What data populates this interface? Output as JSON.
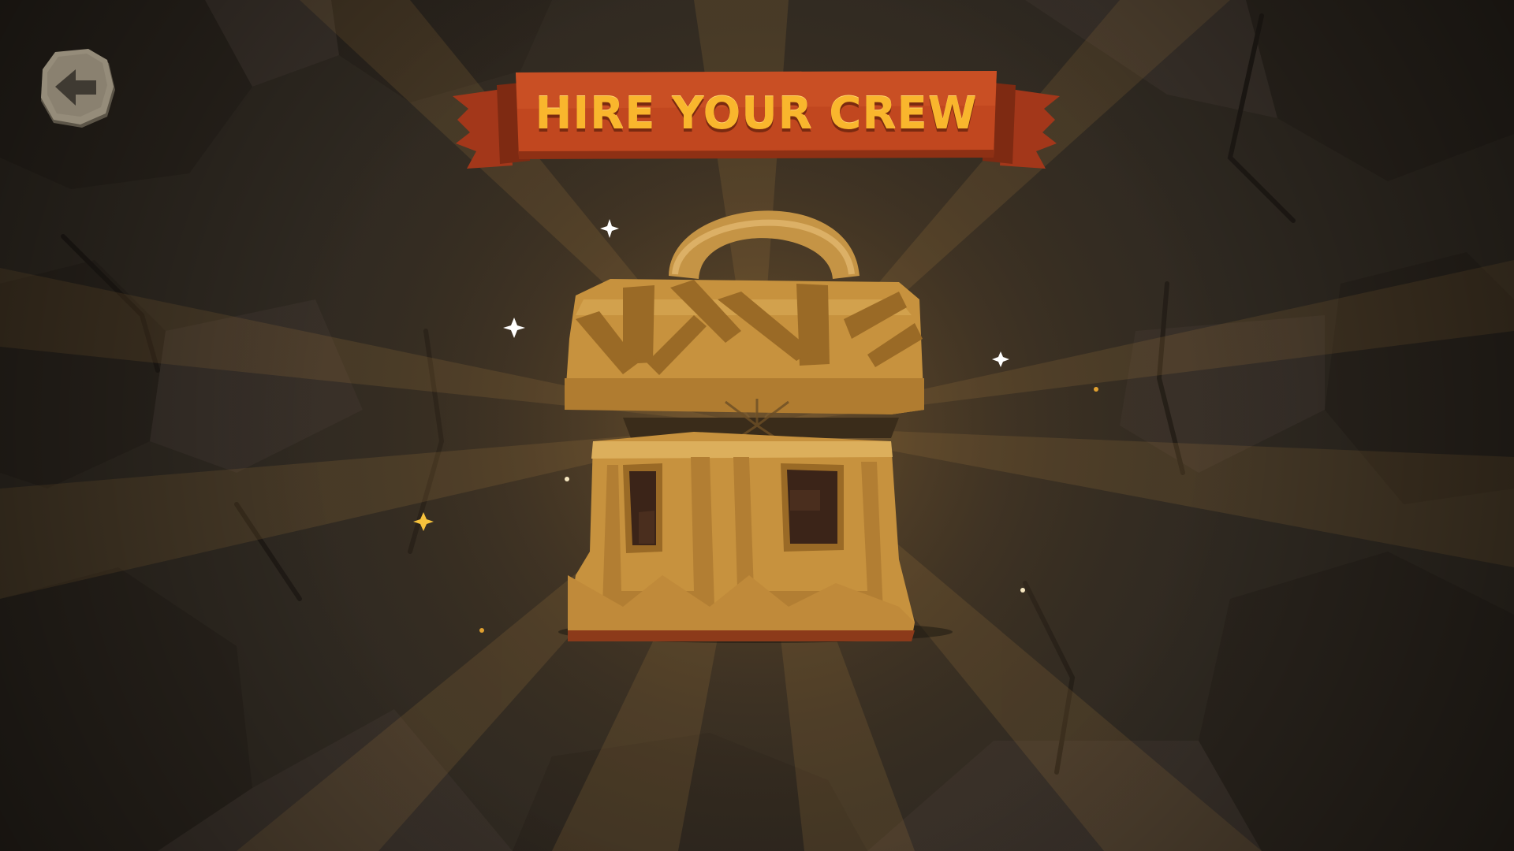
{
  "screen": {
    "title": "HIRE YOUR CREW"
  },
  "back_button": {
    "icon": "back-arrow-icon"
  },
  "chest": {
    "icon": "treasure-chest-icon",
    "state": "open"
  },
  "colors": {
    "background": "#2d271f",
    "banner": "#b8431f",
    "title_text": "#f9b62d",
    "chest_gold": "#c8923f",
    "stone_button": "#8e8574"
  }
}
